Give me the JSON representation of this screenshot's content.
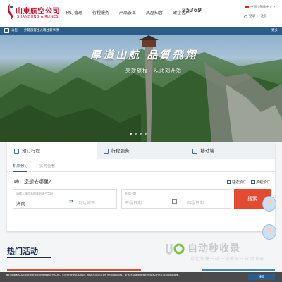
{
  "header": {
    "logo_cn": "山東航空公司",
    "logo_en": "SHANDONG AIRLINES",
    "nav": [
      "预订管理",
      "行程服务",
      "产品荟萃",
      "凤凰知音",
      "政企客户"
    ],
    "hotline": "95369",
    "hotline_sub": "",
    "lang": "中国 | 简体中文 ▾",
    "login": "登录",
    "register": "注册",
    "brand_color": "#c8102e",
    "accent_color": "#2c5d8a"
  },
  "notice": {
    "label": "公告",
    "text": "外籍旅客出入境注意事项",
    "more": "更多"
  },
  "hero": {
    "title": "厚道山航 品質飛翔",
    "subtitle": "美妙旅程，从此刻开始"
  },
  "booking": {
    "tabs": [
      {
        "label": "预订行程",
        "icon": "plane-icon"
      },
      {
        "label": "行程服务",
        "icon": "document-icon"
      },
      {
        "label": "移动端",
        "icon": "mobile-icon"
      }
    ],
    "subtabs": [
      "机票预订",
      "实时查看"
    ],
    "question": "嗨，您想去哪里?",
    "trip_types": [
      "往返预订",
      "多程预订"
    ],
    "from_label": "请输入城市名称或机场三字码",
    "from_value": "济南",
    "to_placeholder": "到达城市",
    "depart_label": "去程日期",
    "depart_placeholder": "去程日期",
    "return_placeholder": "回程日期",
    "search_label": "搜索"
  },
  "hot": {
    "title": "热门活动"
  },
  "watermark": {
    "text": "自动秒收录",
    "sub": "最佳快捷一站一站收录一自动收录"
  },
  "cookie": {
    "text": "我们使用和保存cookie来帮助您获得更好的体验。如您继续使用本网站，即表示您同意我们使用cookies。更多信息请参阅我们的隐私政策以及cookie政策。",
    "button": "接受"
  }
}
